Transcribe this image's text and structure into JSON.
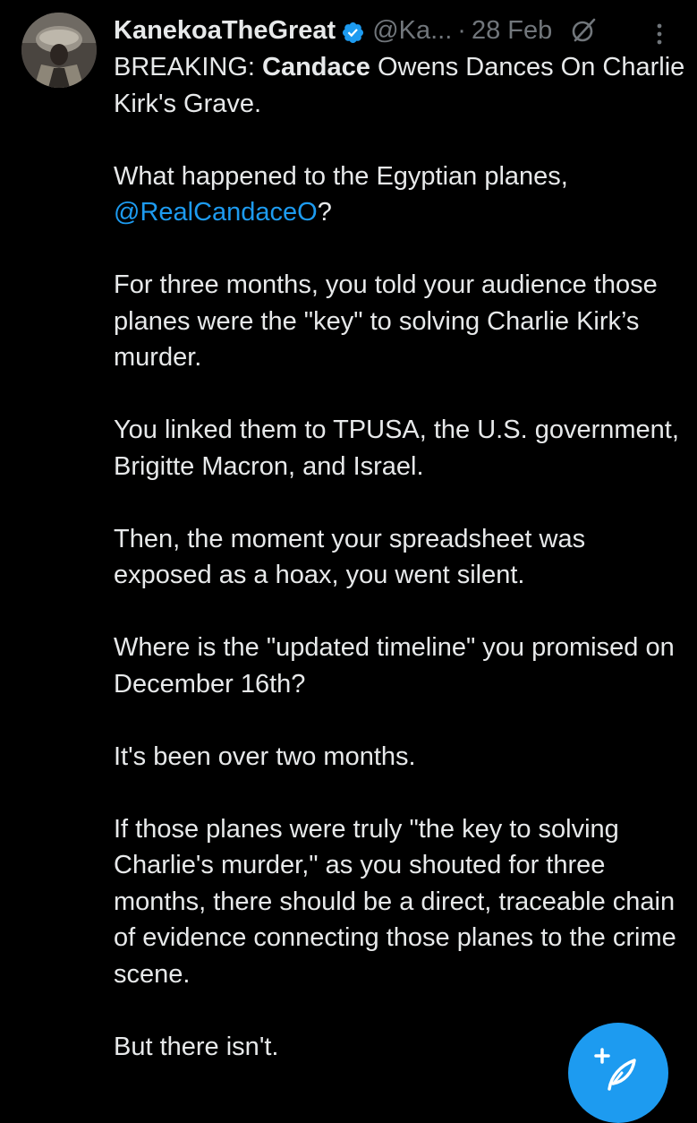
{
  "post": {
    "author": {
      "display_name": "KanekoaTheGreat",
      "handle": "@Ka...",
      "verified": true,
      "avatar_icon": "user-avatar-photo"
    },
    "separator": "·",
    "timestamp": "28 Feb",
    "grok_icon": "grok-slash-circle-icon",
    "more_icon": "vertical-ellipsis-icon",
    "body": {
      "line1_prefix": "BREAKING: ",
      "line1_bold": "Candace",
      "line1_rest": " Owens Dances On Charlie Kirk's Grave.",
      "p2_text": "What happened to the Egyptian planes, ",
      "p2_mention": "@RealCandaceO",
      "p2_suffix": "?",
      "p3": "For three months, you told your audience those planes were the \"key\" to solving Charlie Kirk’s murder.",
      "p4": "You linked them to TPUSA, the U.S. government, Brigitte Macron, and Israel.",
      "p5": "Then, the moment your spreadsheet was exposed as a hoax, you went silent.",
      "p6": "Where is the \"updated timeline\" you promised on December 16th?",
      "p7": "It's been over two months.",
      "p8": "If those planes were truly \"the key to solving Charlie's murder,\" as you shouted for three months, there should be a direct, traceable chain of evidence connecting those planes to the crime scene.",
      "p9": "But there isn't."
    }
  },
  "compose_button": {
    "icon": "compose-feather-plus-icon"
  },
  "colors": {
    "background": "#000000",
    "text": "#e7e9ea",
    "muted": "#71767b",
    "accent": "#1d9bf0"
  }
}
